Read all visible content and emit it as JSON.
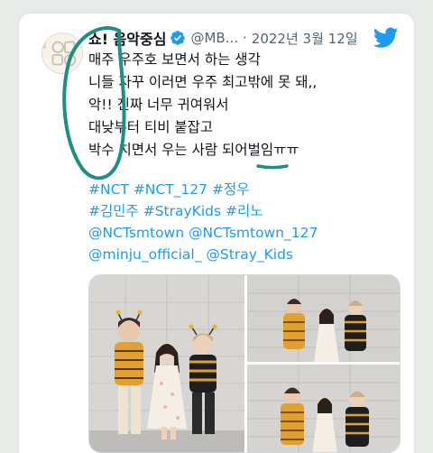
{
  "tweet": {
    "display_name": "쇼! 음악중심",
    "handle": "@MB...",
    "separator": "·",
    "date": "2022년 3월 12일",
    "lines": [
      "매주 우주호 보면서 하는 생각",
      "니들 자꾸 이러면 우주 최고밖에 못 돼,,",
      "악!! 진짜 너무 귀여워서",
      "대낮부터 티비 붙잡고",
      "박수 치면서 우는 사람 되어벌임ㅠㅠ"
    ],
    "hashtag_lines": [
      [
        "#NCT",
        "#NCT_127",
        "#정우"
      ],
      [
        "#김민주",
        "#StrayKids",
        "#리노"
      ],
      [
        "@NCTsmtown",
        "@NCTsmtown_127"
      ],
      [
        "@minju_official_",
        "@Stray_Kids"
      ]
    ]
  },
  "avatar_text": "SHOW 음악중심",
  "colors": {
    "link": "#1d9bf0",
    "text": "#0f1419",
    "secondary": "#536471",
    "verified": "#1d9bf0",
    "annotation": "#1f8e85"
  },
  "icons": {
    "verified": "verified-badge-icon",
    "brand": "twitter-bird-icon"
  }
}
